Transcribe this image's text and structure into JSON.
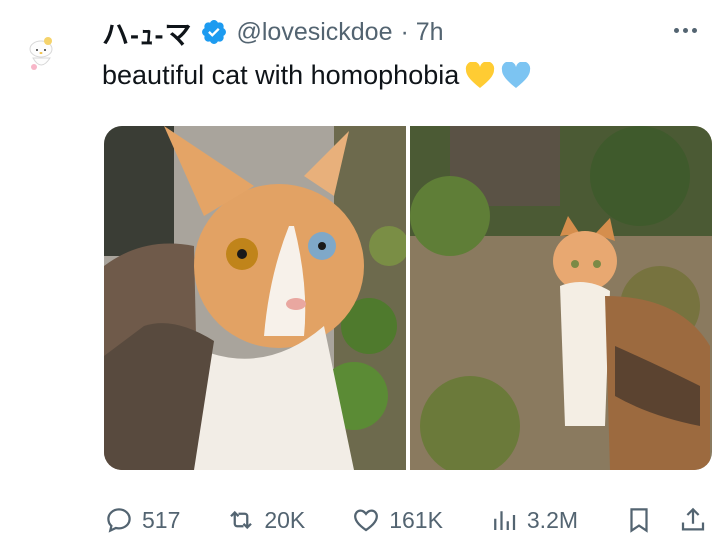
{
  "author": {
    "display_name": "ハ-ｭ-マ",
    "handle": "@lovesickdoe",
    "time": "· 7h",
    "verified": true,
    "avatar_icon": "hello-kitty-avatar"
  },
  "tweet": {
    "text": "beautiful cat with homophobia",
    "emojis": [
      "yellow-heart-icon",
      "blue-heart-icon"
    ]
  },
  "media": {
    "images": [
      {
        "subject": "calico-cat-closeup-heterochromia"
      },
      {
        "subject": "calico-cat-in-leaves"
      }
    ]
  },
  "actions": {
    "replies": "517",
    "reposts": "20K",
    "likes": "161K",
    "views": "3.2M"
  },
  "colors": {
    "text": "#0f1419",
    "secondary": "#536471",
    "verified_blue": "#1d9bf0",
    "heart_yellow": "#ffcc33",
    "heart_blue": "#7cc4f2"
  }
}
